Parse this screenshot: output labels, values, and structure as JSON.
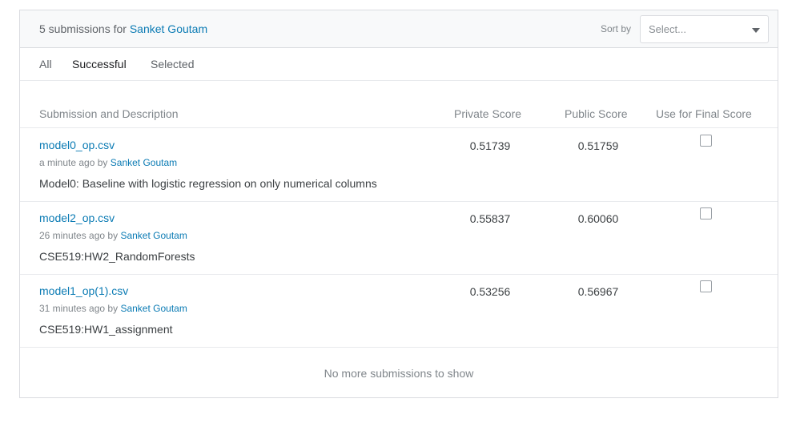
{
  "header": {
    "count_text": "5 submissions for",
    "user_name": "Sanket Goutam",
    "sort_label": "Sort by",
    "sort_placeholder": "Select..."
  },
  "tabs": [
    {
      "label": "All",
      "active": false
    },
    {
      "label": "Successful",
      "active": true
    },
    {
      "label": "Selected",
      "active": false
    }
  ],
  "columns": {
    "submission": "Submission and Description",
    "private_score": "Private Score",
    "public_score": "Public Score",
    "final_score": "Use for Final Score"
  },
  "rows": [
    {
      "filename": "model0_op.csv",
      "time": "a minute ago",
      "by": "by",
      "user": "Sanket Goutam",
      "description": "Model0: Baseline with logistic regression on only numerical columns",
      "private_score": "0.51739",
      "public_score": "0.51759",
      "use_for_final": false
    },
    {
      "filename": "model2_op.csv",
      "time": "26 minutes ago",
      "by": "by",
      "user": "Sanket Goutam",
      "description": "CSE519:HW2_RandomForests",
      "private_score": "0.55837",
      "public_score": "0.60060",
      "use_for_final": false
    },
    {
      "filename": "model1_op(1).csv",
      "time": "31 minutes ago",
      "by": "by",
      "user": "Sanket Goutam",
      "description": "CSE519:HW1_assignment",
      "private_score": "0.53256",
      "public_score": "0.56967",
      "use_for_final": false
    }
  ],
  "footer": {
    "no_more": "No more submissions to show"
  }
}
